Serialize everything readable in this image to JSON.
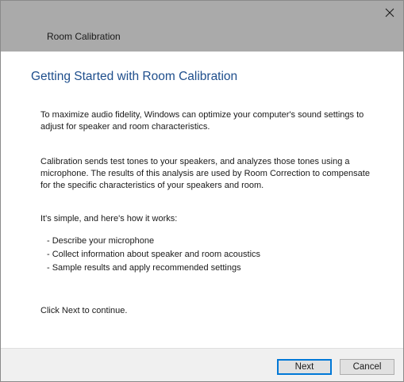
{
  "window": {
    "title": "Room Calibration"
  },
  "main": {
    "heading": "Getting Started with Room Calibration",
    "intro_lines": [
      "To maximize audio fidelity, Windows can optimize your computer's sound settings to",
      "adjust for speaker and room characteristics."
    ],
    "calibration_lines": [
      "Calibration sends test tones to your speakers, and analyzes those tones using a",
      "microphone.  The results of this analysis are used by Room Correction to compensate",
      "for the specific characteristics of your speakers and room."
    ],
    "how_it_works": "It's simple, and here's how it works:",
    "steps": [
      "- Describe your microphone",
      "- Collect information about speaker and room acoustics",
      "- Sample results and apply recommended settings"
    ],
    "continue_text": "Click Next to continue."
  },
  "footer": {
    "next_label": "Next",
    "cancel_label": "Cancel"
  },
  "icons": {
    "close": "close-icon"
  },
  "colors": {
    "heading": "#1e4e8c",
    "titlebar": "#aaaaaa",
    "footer": "#f0f0f0",
    "default_button_border": "#0078d7"
  }
}
